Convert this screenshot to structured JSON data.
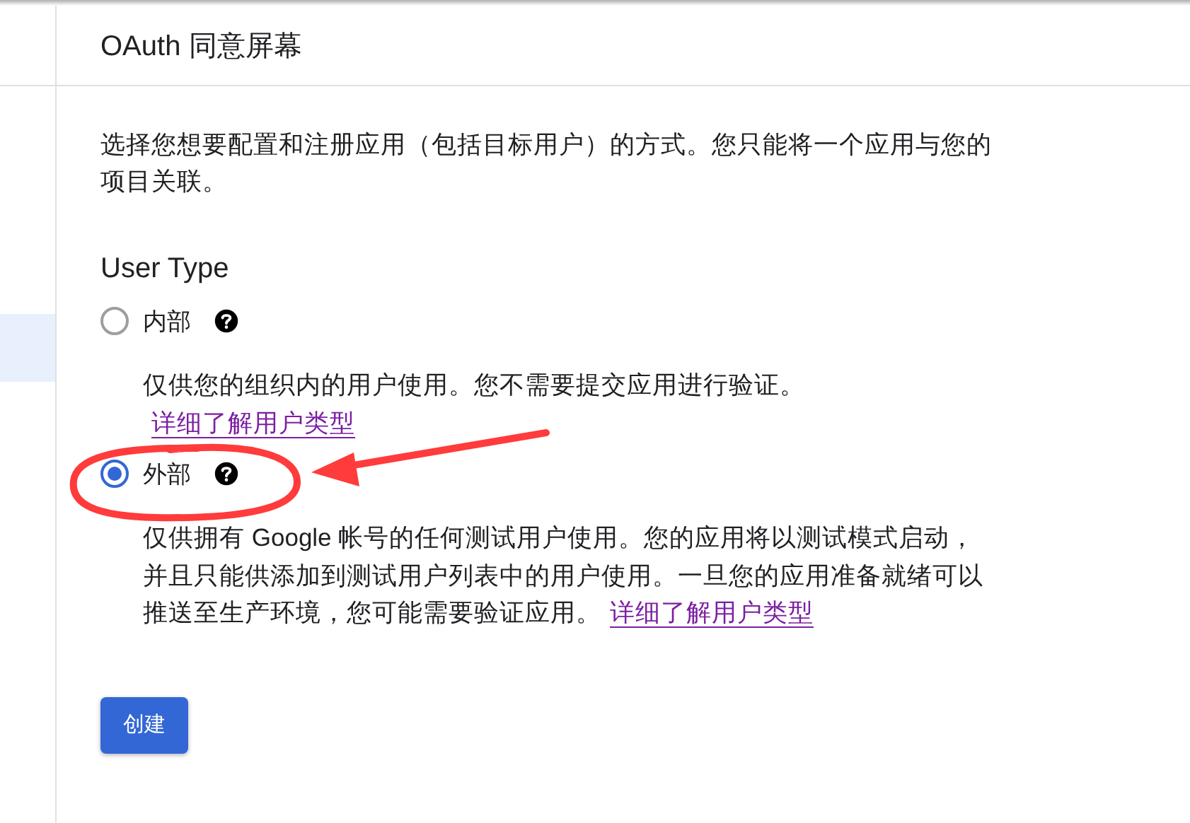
{
  "page": {
    "title": "OAuth 同意屏幕"
  },
  "intro": "选择您想要配置和注册应用（包括目标用户）的方式。您只能将一个应用与您的项目关联。",
  "user_type": {
    "heading": "User Type",
    "options": [
      {
        "label": "内部",
        "selected": false,
        "description": "仅供您的组织内的用户使用。您不需要提交应用进行验证。",
        "link": "详细了解用户类型"
      },
      {
        "label": "外部",
        "selected": true,
        "description": "仅供拥有 Google 帐号的任何测试用户使用。您的应用将以测试模式启动，并且只能供添加到测试用户列表中的用户使用。一旦您的应用准备就绪可以推送至生产环境，您可能需要验证应用。",
        "link": "详细了解用户类型"
      }
    ]
  },
  "buttons": [
    {
      "label": "创建"
    }
  ]
}
